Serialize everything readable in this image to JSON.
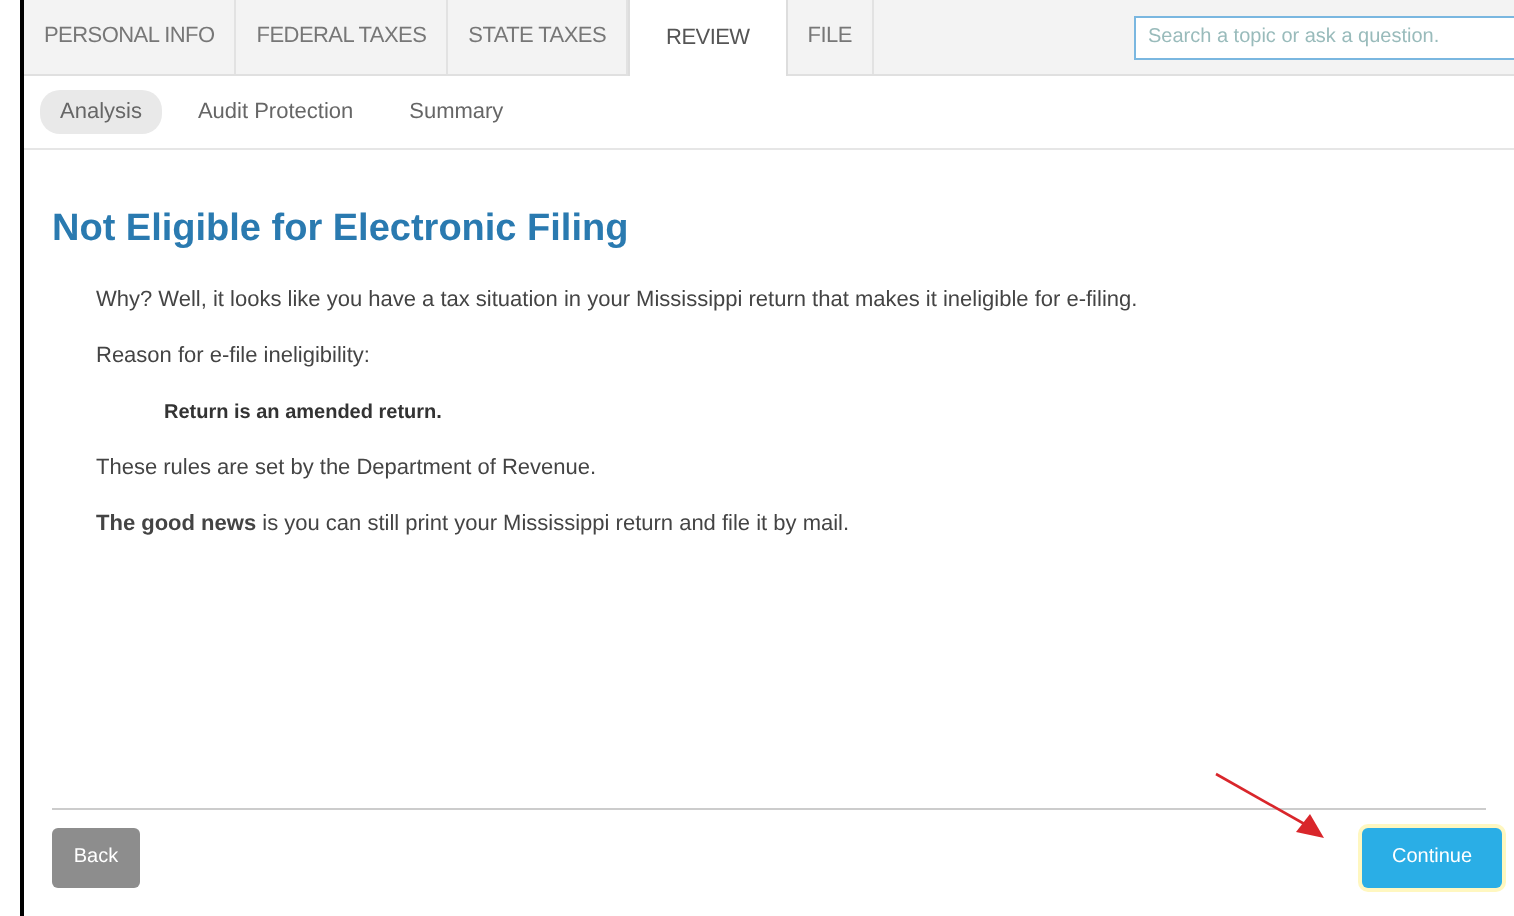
{
  "tabs": [
    {
      "label": "PERSONAL INFO",
      "selected": false
    },
    {
      "label": "FEDERAL TAXES",
      "selected": false
    },
    {
      "label": "STATE TAXES",
      "selected": false
    },
    {
      "label": "REVIEW",
      "selected": true
    },
    {
      "label": "FILE",
      "selected": false
    }
  ],
  "search": {
    "placeholder": "Search a topic or ask a question."
  },
  "subtabs": [
    {
      "label": "Analysis",
      "selected": true
    },
    {
      "label": "Audit Protection",
      "selected": false
    },
    {
      "label": "Summary",
      "selected": false
    }
  ],
  "title": "Not Eligible for Electronic Filing",
  "intro": "Why? Well, it looks like you have a tax situation in your Mississippi return that makes it ineligible for e-filing.",
  "reason_label": "Reason for e-file ineligibility:",
  "reason": "Return is an amended return.",
  "rules_note": "These rules are set by the Department of Revenue.",
  "good_news": "**The good news** is you can still print your Mississippi return and file it by mail.",
  "buttons": {
    "back": "Back",
    "continue": "Continue"
  }
}
